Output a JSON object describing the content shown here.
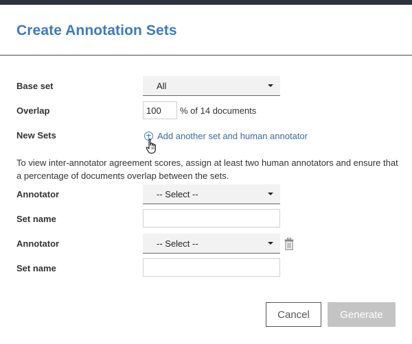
{
  "dialog": {
    "title": "Create Annotation Sets"
  },
  "form": {
    "base_set": {
      "label": "Base set",
      "value": "All"
    },
    "overlap": {
      "label": "Overlap",
      "value": "100",
      "suffix": "% of 14 documents"
    },
    "new_sets": {
      "label": "New Sets",
      "add_link": "Add another set and human annotator"
    },
    "info_text": "To view inter-annotator agreement scores, assign at least two human annotators and ensure that a percentage of documents overlap between the sets.",
    "sets": [
      {
        "annotator_label": "Annotator",
        "annotator_value": "-- Select --",
        "set_name_label": "Set name",
        "set_name_value": ""
      },
      {
        "annotator_label": "Annotator",
        "annotator_value": "-- Select --",
        "set_name_label": "Set name",
        "set_name_value": ""
      }
    ]
  },
  "actions": {
    "cancel": "Cancel",
    "generate": "Generate"
  },
  "colors": {
    "accent": "#3c7bc3",
    "top_bar": "#2a3440",
    "disabled_button": "#c4c4c4"
  },
  "icons": {
    "add": "plus-circle-icon",
    "delete": "trash-icon",
    "cursor": "hand-pointer-icon",
    "dropdown": "caret-down-icon"
  }
}
